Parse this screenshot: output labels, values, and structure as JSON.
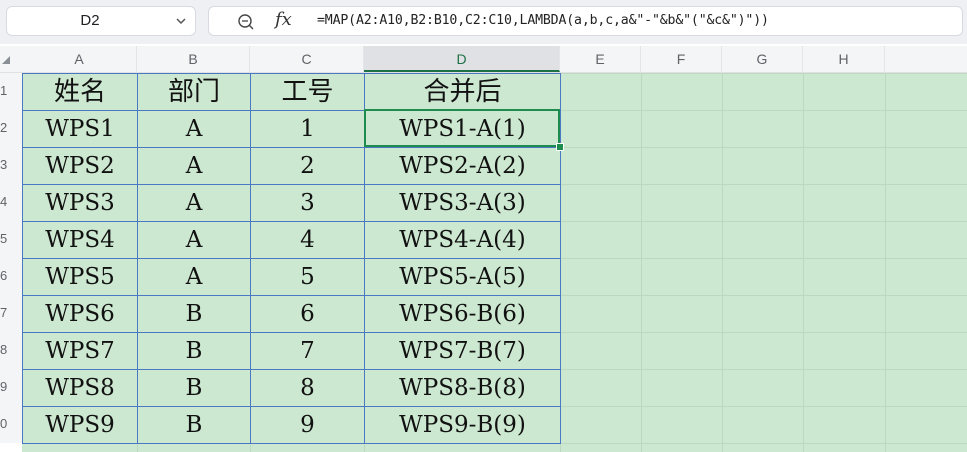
{
  "name_box": {
    "value": "D2"
  },
  "formula_bar": {
    "fx_label": "fx",
    "formula": "=MAP(A2:A10,B2:B10,C2:C10,LAMBDA(a,b,c,a&\"-\"&b&\"(\"&c&\")\"))"
  },
  "columns": [
    "A",
    "B",
    "C",
    "D",
    "E",
    "F",
    "G",
    "H"
  ],
  "active_column": "D",
  "rows": [
    "1",
    "2",
    "3",
    "4",
    "5",
    "6",
    "7",
    "8",
    "9",
    "0"
  ],
  "table": {
    "headers": [
      "姓名",
      "部门",
      "工号",
      "合并后"
    ],
    "rows": [
      [
        "WPS1",
        "A",
        "1",
        "WPS1-A(1)"
      ],
      [
        "WPS2",
        "A",
        "2",
        "WPS2-A(2)"
      ],
      [
        "WPS3",
        "A",
        "3",
        "WPS3-A(3)"
      ],
      [
        "WPS4",
        "A",
        "4",
        "WPS4-A(4)"
      ],
      [
        "WPS5",
        "A",
        "5",
        "WPS5-A(5)"
      ],
      [
        "WPS6",
        "B",
        "6",
        "WPS6-B(6)"
      ],
      [
        "WPS7",
        "B",
        "7",
        "WPS7-B(7)"
      ],
      [
        "WPS8",
        "B",
        "8",
        "WPS8-B(8)"
      ],
      [
        "WPS9",
        "B",
        "9",
        "WPS9-B(9)"
      ]
    ]
  },
  "colors": {
    "sheet_fill": "#cde8d1",
    "selection": "#1e8c4e",
    "table_border": "#4a78c2"
  },
  "icons": {
    "zoom": "zoom-magnifier-icon",
    "chevron": "chevron-down-icon",
    "select_all": "select-all-triangle-icon"
  }
}
